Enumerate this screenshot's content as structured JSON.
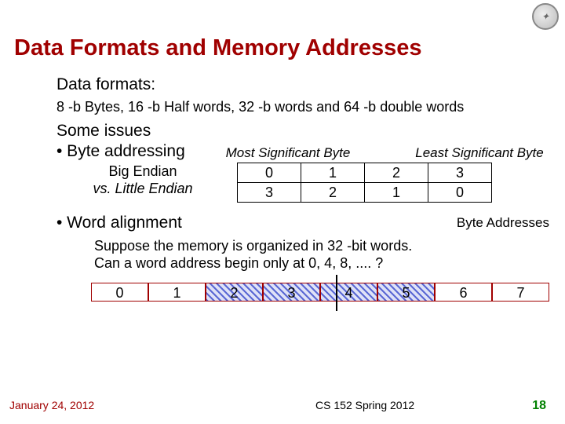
{
  "title": "Data Formats and Memory Addresses",
  "subhead": "Data formats:",
  "formats_line": "8 -b Bytes, 16 -b Half words, 32 -b words and 64 -b double words",
  "issues_head": "Some issues",
  "bullet_byte": "• Byte addressing",
  "msb_label": "Most Significant Byte",
  "lsb_label": "Least Significant Byte",
  "endian_big_label": "Big Endian",
  "endian_vs_label": "vs. Little Endian",
  "endian_rows": {
    "big": [
      "0",
      "1",
      "2",
      "3"
    ],
    "little": [
      "3",
      "2",
      "1",
      "0"
    ]
  },
  "bullet_word": "• Word alignment",
  "byte_addresses_label": "Byte Addresses",
  "suppose_line1": "Suppose the memory is organized in 32 -bit words.",
  "suppose_line2": "Can a word address begin only at 0, 4, 8, .... ?",
  "word_strip": [
    "0",
    "1",
    "2",
    "3",
    "4",
    "5",
    "6",
    "7"
  ],
  "hatched_indices": [
    2,
    3,
    4,
    5
  ],
  "footer": {
    "date": "January 24, 2012",
    "course": "CS 152 Spring 2012",
    "page": "18"
  },
  "chart_data": {
    "type": "table",
    "title": "Byte ordering in a 32-bit word",
    "columns": [
      "Most Significant Byte",
      "",
      "",
      "Least Significant Byte"
    ],
    "series": [
      {
        "name": "Big Endian",
        "values": [
          0,
          1,
          2,
          3
        ]
      },
      {
        "name": "Little Endian",
        "values": [
          3,
          2,
          1,
          0
        ]
      }
    ]
  }
}
